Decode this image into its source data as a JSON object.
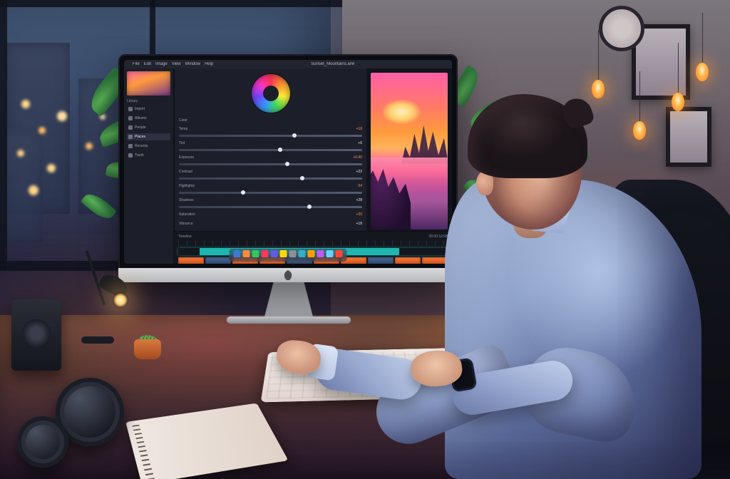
{
  "scene": {
    "description": "A man at a wooden desk in a warmly lit home office at dusk edits a vivid sunset landscape on an all-in-one computer; plants, a desk lamp, notebook, camera lenses, a glowing candle, and hanging Edison bulbs surround him with a city view through the window.",
    "lighting": "warm tungsten + cool window twilight",
    "time_of_day": "dusk"
  },
  "monitor": {
    "menubar": {
      "apple": "",
      "items": [
        "File",
        "Edit",
        "Image",
        "View",
        "Window",
        "Help"
      ],
      "title": "Sunset_Mountains.arw"
    },
    "left_panel": {
      "section": "Library",
      "items": [
        "Import",
        "Albums",
        "People",
        "Places",
        "Recents",
        "Trash"
      ]
    },
    "right_panel": {
      "header": "Color",
      "controls": [
        {
          "label": "Temp",
          "value": "+18"
        },
        {
          "label": "Tint",
          "value": "+6"
        },
        {
          "label": "Exposure",
          "value": "+0.40"
        },
        {
          "label": "Contrast",
          "value": "+22"
        },
        {
          "label": "Highlights",
          "value": "-34"
        },
        {
          "label": "Shadows",
          "value": "+28"
        },
        {
          "label": "Saturation",
          "value": "+30"
        },
        {
          "label": "Vibrance",
          "value": "+18"
        }
      ]
    },
    "timeline": {
      "label": "Timeline",
      "timecode": "00:00:12:08"
    },
    "dock_apps": [
      "#3a7bd5",
      "#ff8a3c",
      "#34c759",
      "#ff375f",
      "#5e5ce6",
      "#ffd60a",
      "#8e8e93",
      "#30b0c7",
      "#ff9f0a",
      "#bf5af2",
      "#64d2ff",
      "#ff453a"
    ]
  }
}
